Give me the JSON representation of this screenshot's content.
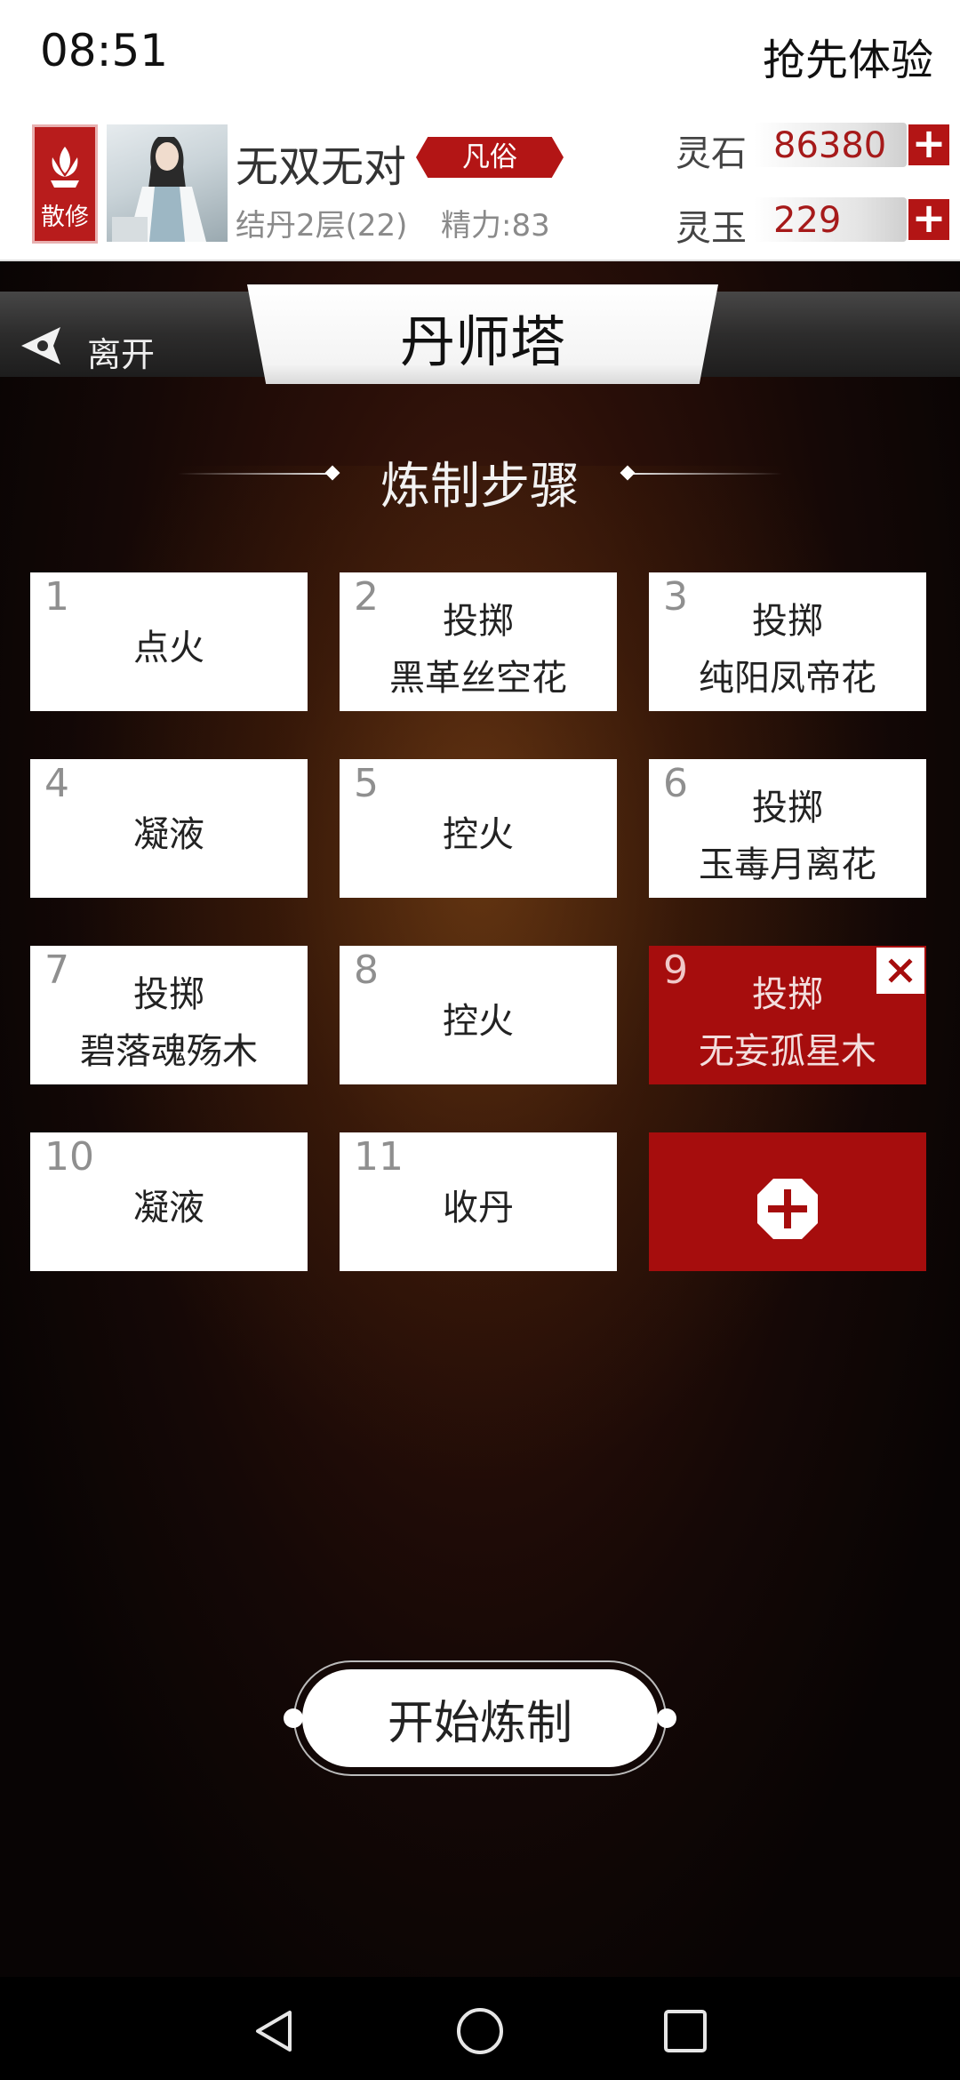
{
  "status_bar": {
    "time": "08:51",
    "trial_label": "抢先体验"
  },
  "player": {
    "sect": "散修",
    "name": "无双无对",
    "rank": "凡俗",
    "realm": "结丹2层(22)",
    "energy": "精力:83"
  },
  "resources": [
    {
      "label": "灵石",
      "value": "86380",
      "plus": "+"
    },
    {
      "label": "灵玉",
      "value": "229",
      "plus": "+"
    }
  ],
  "nav": {
    "leave": "离开"
  },
  "page_title": "丹师塔",
  "steps_title": "炼制步骤",
  "steps": [
    {
      "num": "1",
      "line1": "点火",
      "line2": ""
    },
    {
      "num": "2",
      "line1": "投掷",
      "line2": "黑革丝空花"
    },
    {
      "num": "3",
      "line1": "投掷",
      "line2": "纯阳凤帝花"
    },
    {
      "num": "4",
      "line1": "凝液",
      "line2": ""
    },
    {
      "num": "5",
      "line1": "控火",
      "line2": ""
    },
    {
      "num": "6",
      "line1": "投掷",
      "line2": "玉毒月离花"
    },
    {
      "num": "7",
      "line1": "投掷",
      "line2": "碧落魂殇木"
    },
    {
      "num": "8",
      "line1": "控火",
      "line2": ""
    },
    {
      "num": "9",
      "line1": "投掷",
      "line2": "无妄孤星木",
      "selected": true
    },
    {
      "num": "10",
      "line1": "凝液",
      "line2": ""
    },
    {
      "num": "11",
      "line1": "收丹",
      "line2": ""
    }
  ],
  "start_button": "开始炼制",
  "colors": {
    "accent": "#a60d0d",
    "resource_value": "#a61a1a"
  }
}
